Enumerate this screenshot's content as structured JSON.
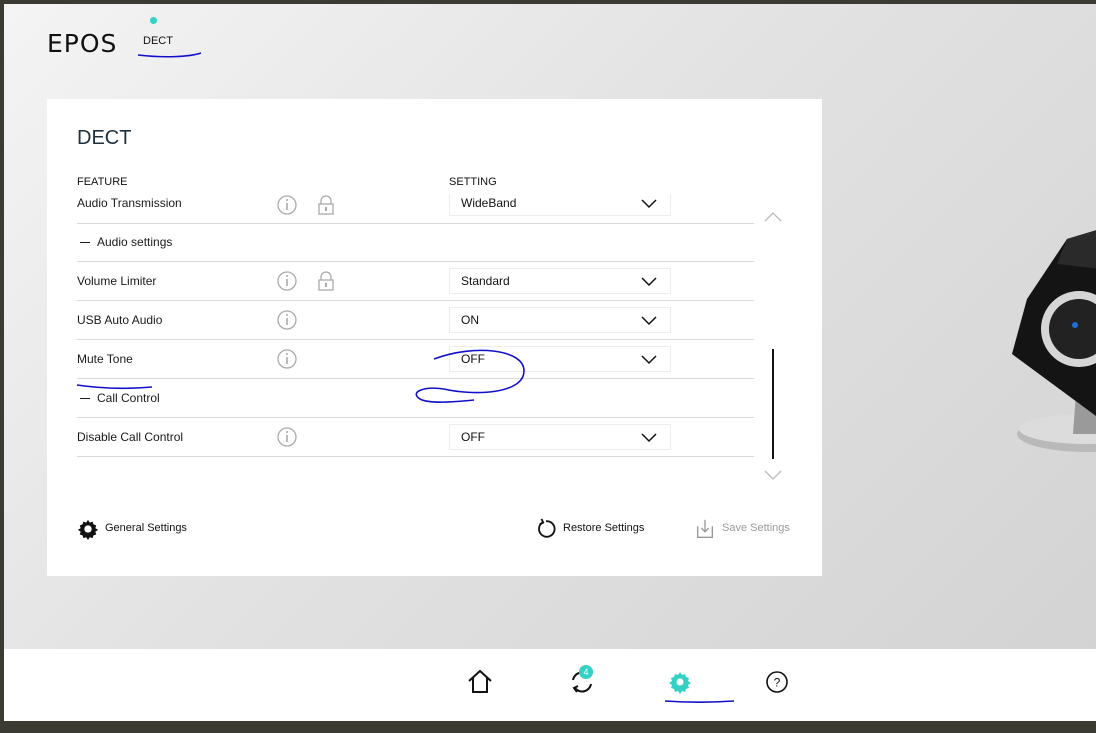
{
  "header": {
    "logo": "EPOS",
    "device_tab": "DECT"
  },
  "panel": {
    "title": "DECT",
    "col_feature": "FEATURE",
    "col_setting": "SETTING",
    "rows": {
      "audio_transmission": {
        "label": "Audio Transmission",
        "value": "WideBand"
      },
      "audio_settings_group": "Audio settings",
      "volume_limiter": {
        "label": "Volume Limiter",
        "value": "Standard"
      },
      "usb_auto_audio": {
        "label": "USB Auto Audio",
        "value": "ON"
      },
      "mute_tone": {
        "label": "Mute Tone",
        "value": "OFF"
      },
      "call_control_group": "Call Control",
      "disable_call_control": {
        "label": "Disable Call Control",
        "value": "OFF"
      }
    },
    "actions": {
      "general_settings": "General Settings",
      "restore_settings": "Restore Settings",
      "save_settings": "Save Settings"
    }
  },
  "bottom_nav": {
    "updates_badge": "4",
    "active": "settings"
  },
  "colors": {
    "accent": "#35d0c6",
    "annotation_ink": "#1010c8"
  }
}
